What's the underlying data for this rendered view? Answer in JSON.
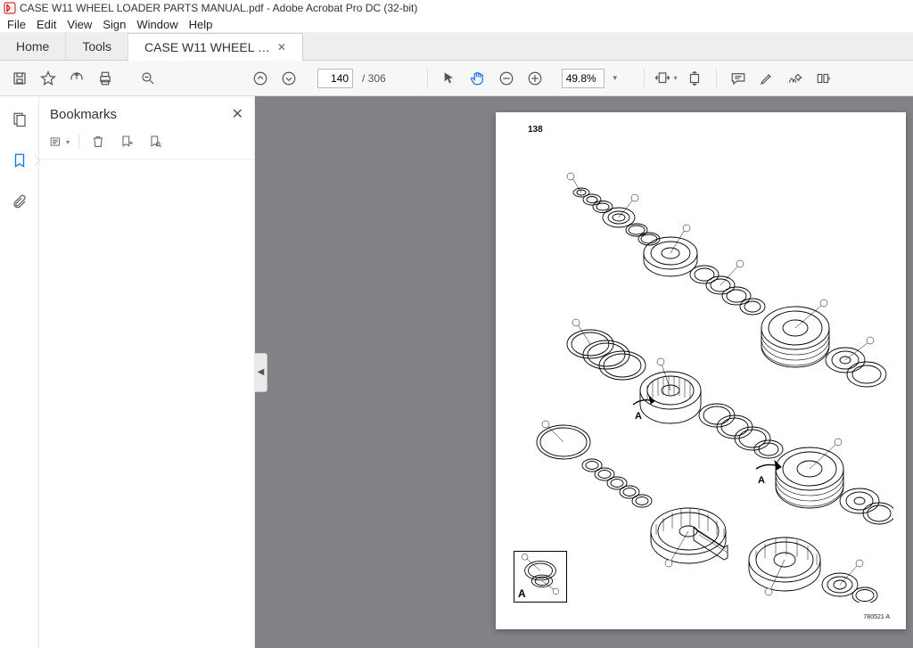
{
  "window": {
    "title": "CASE W11 WHEEL LOADER PARTS MANUAL.pdf - Adobe Acrobat Pro DC (32-bit)"
  },
  "menu": {
    "file": "File",
    "edit": "Edit",
    "view": "View",
    "sign": "Sign",
    "window": "Window",
    "help": "Help"
  },
  "tabs": {
    "home": "Home",
    "tools": "Tools",
    "doc": "CASE W11 WHEEL …"
  },
  "toolbar": {
    "page_current": "140",
    "page_total": "/ 306",
    "zoom": "49.8%"
  },
  "sidebar": {
    "title": "Bookmarks"
  },
  "page": {
    "number": "138",
    "ref": "780521 A",
    "detail_letter": "A",
    "arrow_a": "A",
    "arrow_b": "A"
  }
}
